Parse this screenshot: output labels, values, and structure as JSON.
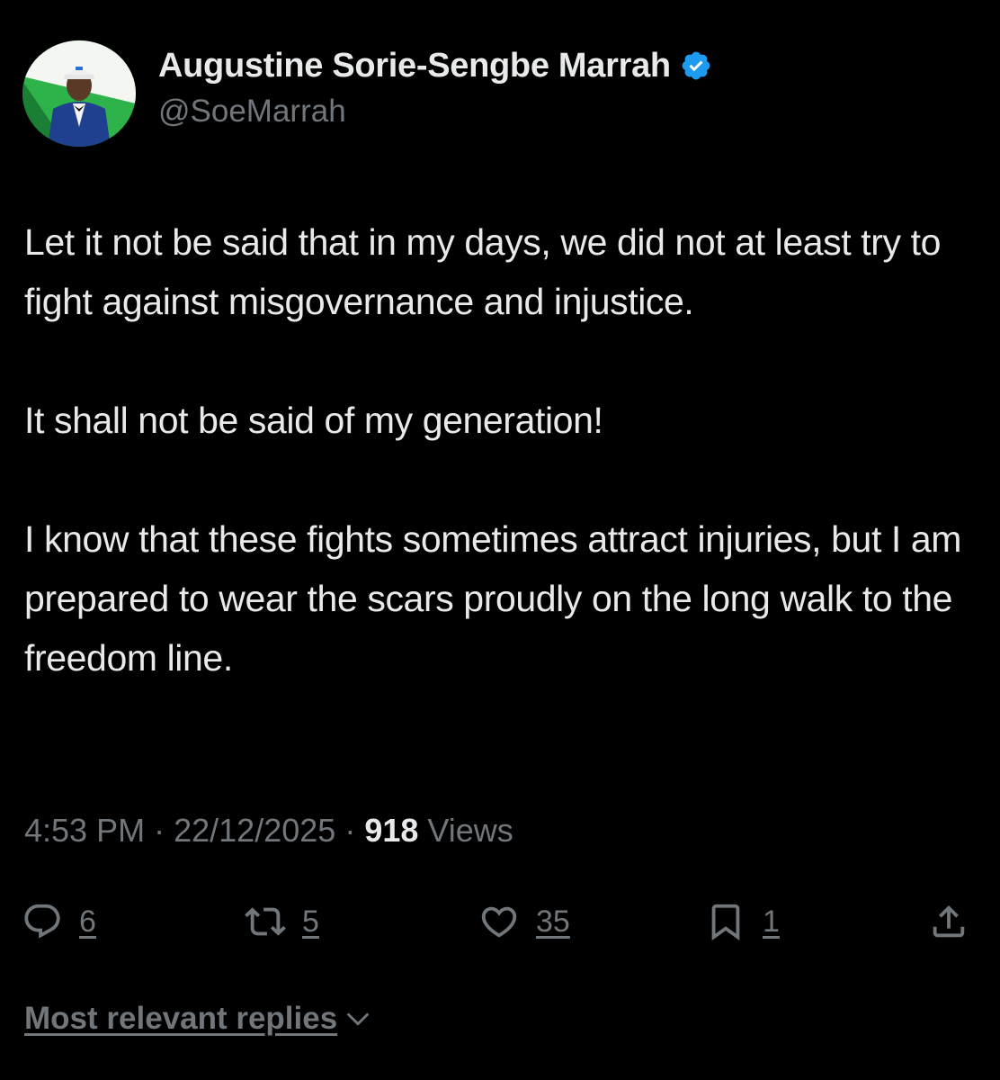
{
  "author": {
    "display_name": "Augustine Sorie-Sengbe Marrah",
    "handle": "@SoeMarrah",
    "verified": true,
    "verified_color": "#1d9bf0"
  },
  "tweet": {
    "paragraphs": [
      "Let it not be said that in my days, we did not at least try to fight against misgovernance and injustice.",
      "It shall not be said of my generation!",
      "I know that these fights sometimes attract injuries, but I am prepared to wear the scars proudly on the long walk to the freedom line."
    ]
  },
  "meta": {
    "time": "4:53 PM",
    "separator": "·",
    "date": "22/12/2025",
    "views_count": "918",
    "views_label": "Views"
  },
  "actions": {
    "reply": {
      "icon": "reply-icon",
      "count": "6"
    },
    "repost": {
      "icon": "repost-icon",
      "count": "5"
    },
    "like": {
      "icon": "heart-icon",
      "count": "35"
    },
    "bookmark": {
      "icon": "bookmark-icon",
      "count": "1"
    },
    "share": {
      "icon": "share-icon"
    }
  },
  "replies": {
    "sort_label": "Most relevant replies",
    "icon": "chevron-down-icon"
  },
  "colors": {
    "background": "#000000",
    "primary_text": "#e7e9ea",
    "secondary_text": "#71767b"
  }
}
